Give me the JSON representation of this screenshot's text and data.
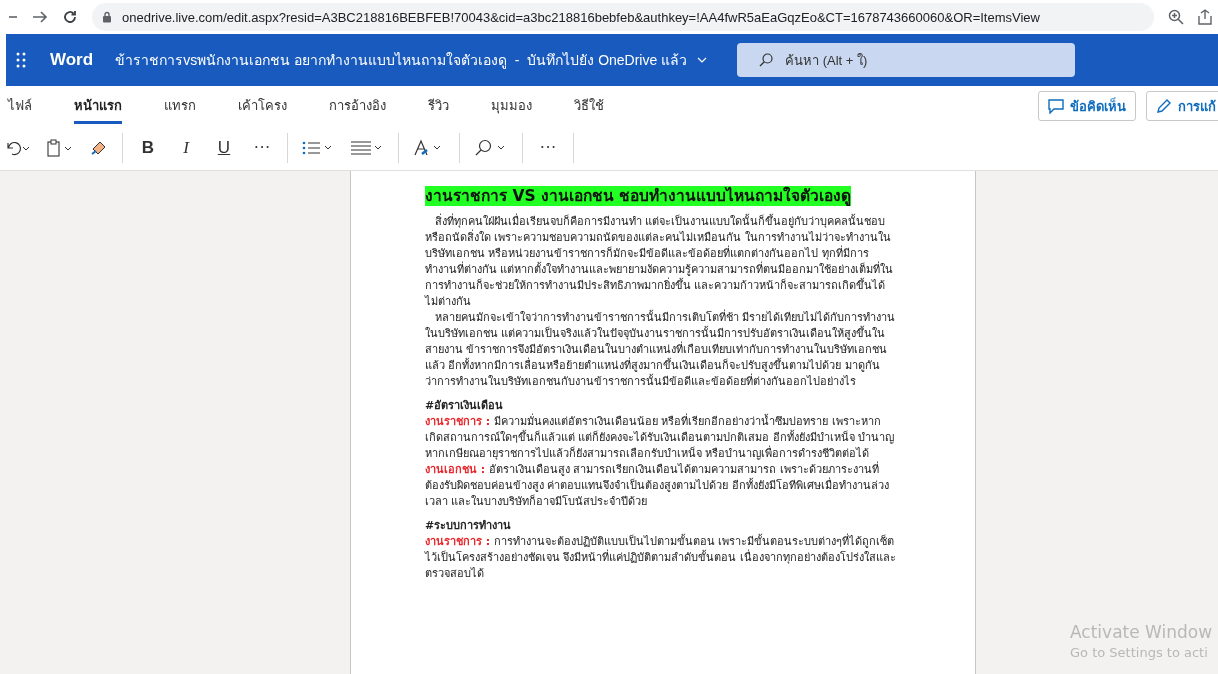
{
  "browser": {
    "url": "onedrive.live.com/edit.aspx?resid=A3BC218816BEBFEB!70043&cid=a3bc218816bebfeb&authkey=!AA4fwR5aEaGqzEo&CT=1678743660060&OR=ItemsView"
  },
  "app": {
    "name": "Word",
    "doc_title": "ข้าราชการvsพนักงานเอกชน อยากทำงานแบบไหนถามใจตัวเองดู  -  บันทึกไปยัง OneDrive แล้ว",
    "search_placeholder": "ค้นหา (Alt + ใ)"
  },
  "ribbon_tabs": [
    {
      "label": "ไฟล์",
      "selected": false
    },
    {
      "label": "หน้าแรก",
      "selected": true
    },
    {
      "label": "แทรก",
      "selected": false
    },
    {
      "label": "เค้าโครง",
      "selected": false
    },
    {
      "label": "การอ้างอิง",
      "selected": false
    },
    {
      "label": "รีวิว",
      "selected": false
    },
    {
      "label": "มุมมอง",
      "selected": false
    },
    {
      "label": "วิธีใช้",
      "selected": false
    }
  ],
  "ribbon_buttons": [
    {
      "label": "ข้อคิดเห็น",
      "kind": "comment"
    },
    {
      "label": "การแก้",
      "kind": "edit"
    }
  ],
  "toolbar": {
    "bold": "B",
    "italic": "I",
    "underline": "U",
    "more": [
      "···",
      "···"
    ]
  },
  "document": {
    "title": "งานราชการ VS งานเอกชน ชอบทำงานแบบไหนถามใจตัวเองดู",
    "intro": [
      "สิ่งที่ทุกคนใฝ่ฝันเมื่อเรียนจบก็คือการมีงานทำ แต่จะเป็นงานแบบใดนั้นก็ขึ้นอยู่กับว่าบุคคลนั้นชอบหรือถนัดสิ่งใด เพราะความชอบความถนัดของแต่ละคนไม่เหมือนกัน ในการทำงานไม่ว่าจะทำงานในบริษัทเอกชน หรือหน่วยงานข้าราชการก็มักจะมีข้อดีและข้อด้อยที่แตกต่างกันออกไป ทุกที่มีการทำงานที่ต่างกัน แต่หากตั้งใจทำงานและพยายามงัดความรู้ความสามารถที่ตนมีออกมาใช้อย่างเต็มที่ในการทำงานก็จะช่วยให้การทำงานมีประสิทธิภาพมากยิ่งขึ้น และความก้าวหน้าก็จะสามารถเกิดขึ้นได้ไม่ต่างกัน",
      "หลายคนมักจะเข้าใจว่าการทำงานข้าราชการนั้นมีการเติบโตที่ช้า มีรายได้เทียบไม่ได้กับการทำงานในบริษัทเอกชน แต่ความเป็นจริงแล้วในปัจจุบันงานราชการนั้นมีการปรับอัตราเงินเดือนให้สูงขึ้นในสายงาน ข้าราชการจึงมีอัตราเงินเดือนในบางตำแหน่งที่เกือบเทียบเท่ากับการทำงานในบริษัทเอกชนแล้ว อีกทั้งหากมีการเลื่อนหรือย้ายตำแหน่งที่สูงมากขึ้นเงินเดือนก็จะปรับสูงขึ้นตามไปด้วย มาดูกันว่าการทำงานในบริษัทเอกชนกับงานข้าราชการนั้นมีข้อดีและข้อด้อยที่ต่างกันออกไปอย่างไร"
    ],
    "sections": [
      {
        "heading": "#อัตราเงินเดือน",
        "items": [
          "**งานราชการ :** มีความมั่นคงแต่อัตราเงินเดือนน้อย หรือที่เรียกอีกอย่างว่าน้ำซึมบ่อทราย เพราะหากเกิดสถานการณ์ใดๆขึ้นก็แล้วแต่ แต่ก็ยังคงจะได้รับเงินเดือนตามปกติเสมอ อีกทั้งยังมีบำเหน็จ บำนาญ หากเกษียณอายุราชการไปแล้วก็ยังสามารถเลือกรับบำเหน็จ หรือบำนาญเพื่อการดำรงชีวิตต่อได้",
          "**งานเอกชน :** อัตราเงินเดือนสูง สามารถเรียกเงินเดือนได้ตามความสามารถ เพราะด้วยภาระงานที่ต้องรับผิดชอบค่อนข้างสูง ค่าตอบแทนจึงจำเป็นต้องสูงตามไปด้วย อีกทั้งยังมีโอทีพิเศษเมื่อทำงานล่วงเวลา และในบางบริษัทก็อาจมีโบนัสประจำปีด้วย"
        ]
      },
      {
        "heading": "#ระบบการทำงาน",
        "items": [
          "**งานราชการ :** การทำงานจะต้องปฏิบัติแบบเป็นไปตามขั้นตอน เพราะมีขั้นตอนระบบต่างๆที่ได้ถูกเซ็ตไว้เป็นโครงสร้างอย่างชัดเจน จึงมีหน้าที่แค่ปฏิบัติตามลำดับขั้นตอน เนื่องจากทุกอย่างต้องโปร่งใสและตรวจสอบได้"
        ]
      }
    ]
  },
  "os_notice": {
    "title": "Activate Window",
    "subtitle": "Go to Settings to acti"
  }
}
